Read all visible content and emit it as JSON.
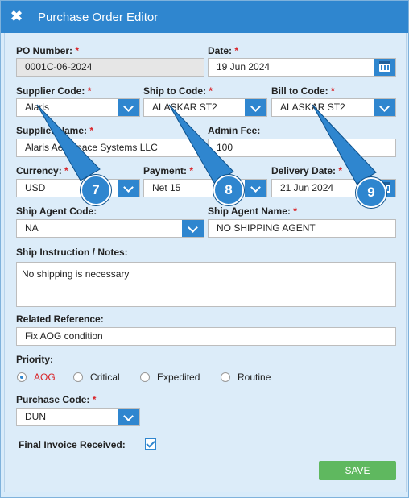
{
  "window": {
    "title": "Purchase Order Editor"
  },
  "form": {
    "po_number": {
      "label": "PO Number:",
      "value": "0001C-06-2024"
    },
    "date": {
      "label": "Date:",
      "value": "19 Jun 2024"
    },
    "supplier_code": {
      "label": "Supplier Code:",
      "value": "Alaris"
    },
    "ship_to_code": {
      "label": "Ship to Code:",
      "value": "ALASKAR ST2"
    },
    "bill_to_code": {
      "label": "Bill to Code:",
      "value": "ALASKAR ST2"
    },
    "supplier_name": {
      "label": "Supplier Name:",
      "value": "Alaris Aerospace Systems LLC"
    },
    "admin_fee": {
      "label": "Admin Fee:",
      "value": "100"
    },
    "currency": {
      "label": "Currency:",
      "value": "USD"
    },
    "payment": {
      "label": "Payment:",
      "value": "Net 15"
    },
    "delivery_date": {
      "label": "Delivery Date:",
      "value": "21 Jun 2024"
    },
    "ship_agent_code": {
      "label": "Ship Agent Code:",
      "value": "NA"
    },
    "ship_agent_name": {
      "label": "Ship Agent Name:",
      "value": "NO SHIPPING AGENT"
    },
    "ship_instruction": {
      "label": "Ship Instruction / Notes:",
      "value": "No shipping is necessary"
    },
    "related_reference": {
      "label": "Related Reference:",
      "value": "Fix AOG condition"
    },
    "priority": {
      "label": "Priority:",
      "options": [
        "AOG",
        "Critical",
        "Expedited",
        "Routine"
      ],
      "selected": "AOG"
    },
    "purchase_code": {
      "label": "Purchase Code:",
      "value": "DUN"
    },
    "final_invoice": {
      "label": "Final Invoice Received:",
      "checked": true
    },
    "required_mark": "*"
  },
  "buttons": {
    "save": "SAVE",
    "close": "✖"
  },
  "callouts": [
    "7",
    "8",
    "9"
  ],
  "colors": {
    "accent": "#2f86cf",
    "save": "#5fb85f",
    "required": "#d9252a",
    "selected_priority": "#d9252a"
  }
}
